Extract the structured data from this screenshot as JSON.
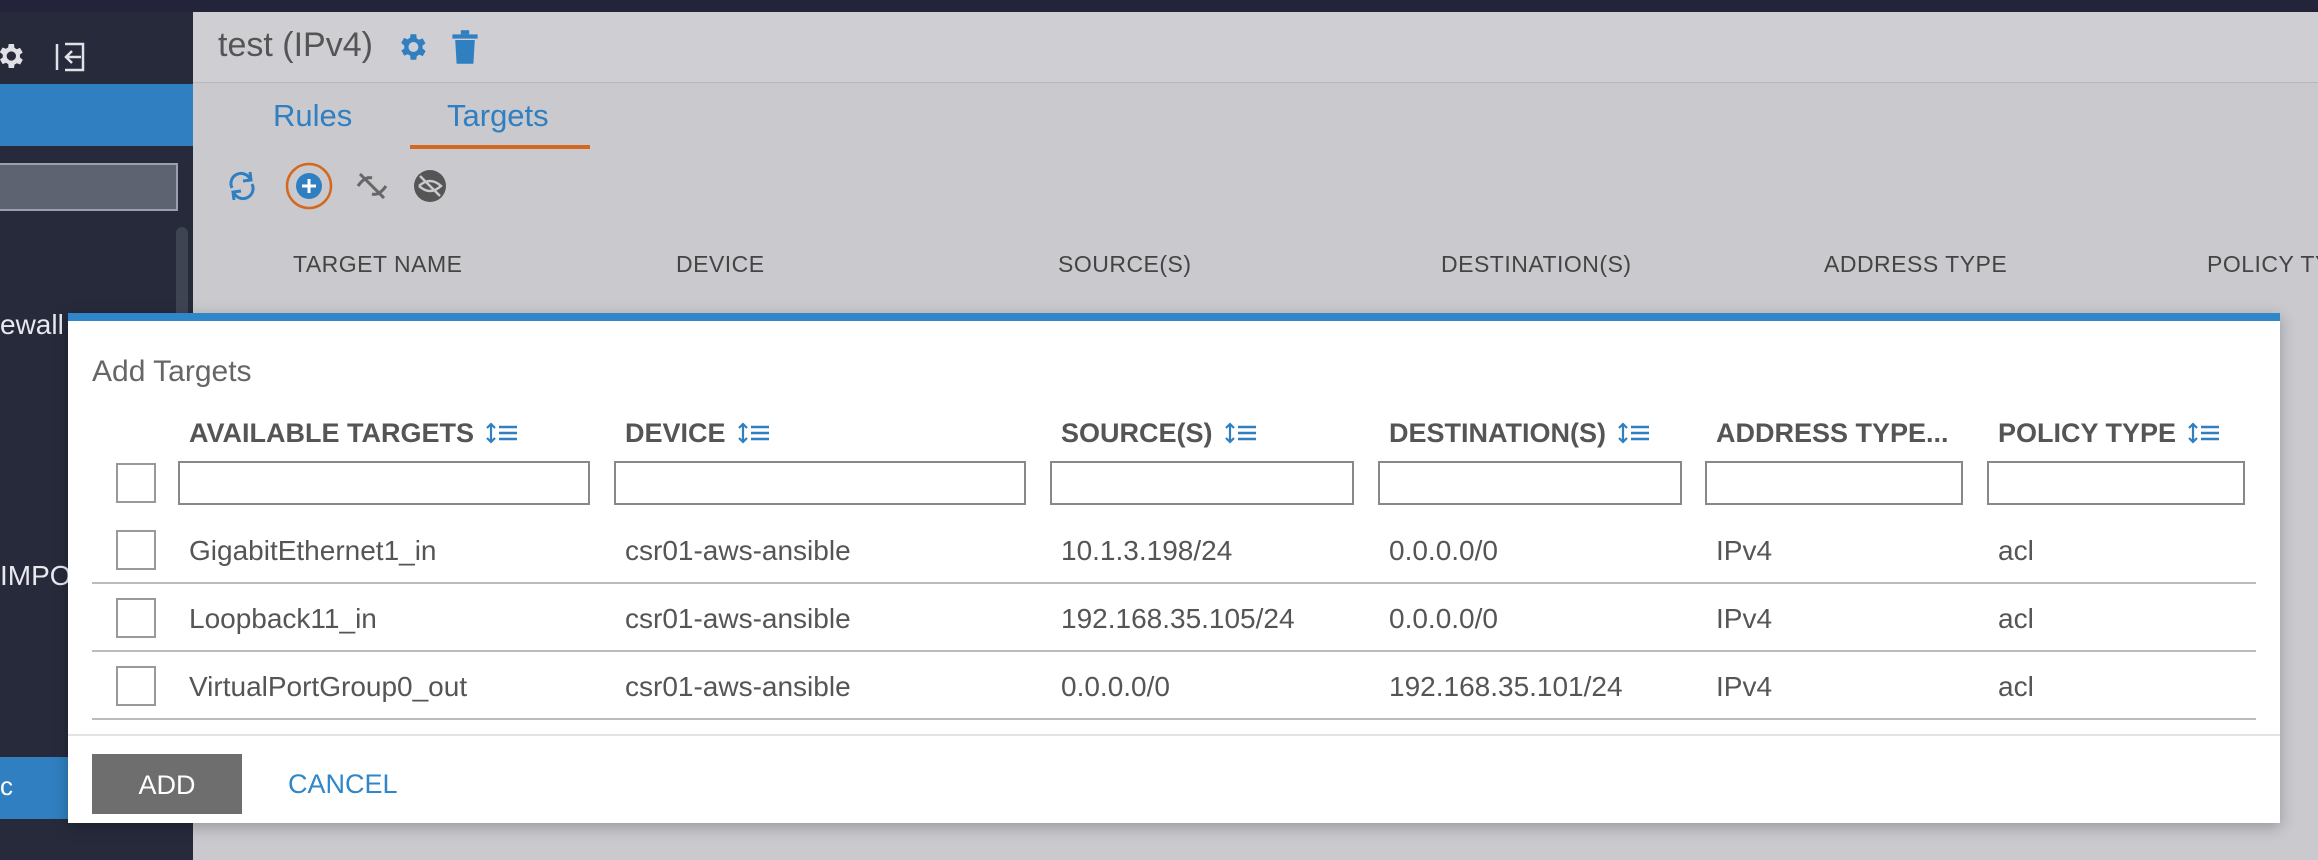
{
  "sidebar": {
    "item_firewall_partial": "ewall",
    "item_import_partial": "IMPO",
    "bottom_item_partial": "c"
  },
  "header": {
    "title": "test (IPv4)"
  },
  "tabs": [
    {
      "label": "Rules",
      "active": false
    },
    {
      "label": "Targets",
      "active": true
    }
  ],
  "toolbar": {
    "icons": [
      "refresh-icon",
      "add-circle-icon",
      "unlink-icon",
      "hide-icon"
    ]
  },
  "background_table": {
    "columns": [
      "TARGET NAME",
      "DEVICE",
      "SOURCE(S)",
      "DESTINATION(S)",
      "ADDRESS TYPE",
      "POLICY TY"
    ]
  },
  "modal": {
    "title": "Add Targets",
    "columns": [
      "AVAILABLE TARGETS",
      "DEVICE",
      "SOURCE(S)",
      "DESTINATION(S)",
      "ADDRESS TYPE...",
      "POLICY TYPE"
    ],
    "rows": [
      {
        "name": "GigabitEthernet1_in",
        "device": "csr01-aws-ansible",
        "source": "10.1.3.198/24",
        "destination": "0.0.0.0/0",
        "address_type": "IPv4",
        "policy_type": "acl"
      },
      {
        "name": "Loopback11_in",
        "device": "csr01-aws-ansible",
        "source": "192.168.35.105/24",
        "destination": "0.0.0.0/0",
        "address_type": "IPv4",
        "policy_type": "acl"
      },
      {
        "name": "VirtualPortGroup0_out",
        "device": "csr01-aws-ansible",
        "source": "0.0.0.0/0",
        "destination": "192.168.35.101/24",
        "address_type": "IPv4",
        "policy_type": "acl"
      }
    ],
    "add_label": "ADD",
    "cancel_label": "CANCEL"
  },
  "colors": {
    "accent": "#2f7fc1",
    "tab_underline": "#d2691e",
    "sidebar_bg": "#262a3b",
    "add_button": "#6e6e6e"
  }
}
